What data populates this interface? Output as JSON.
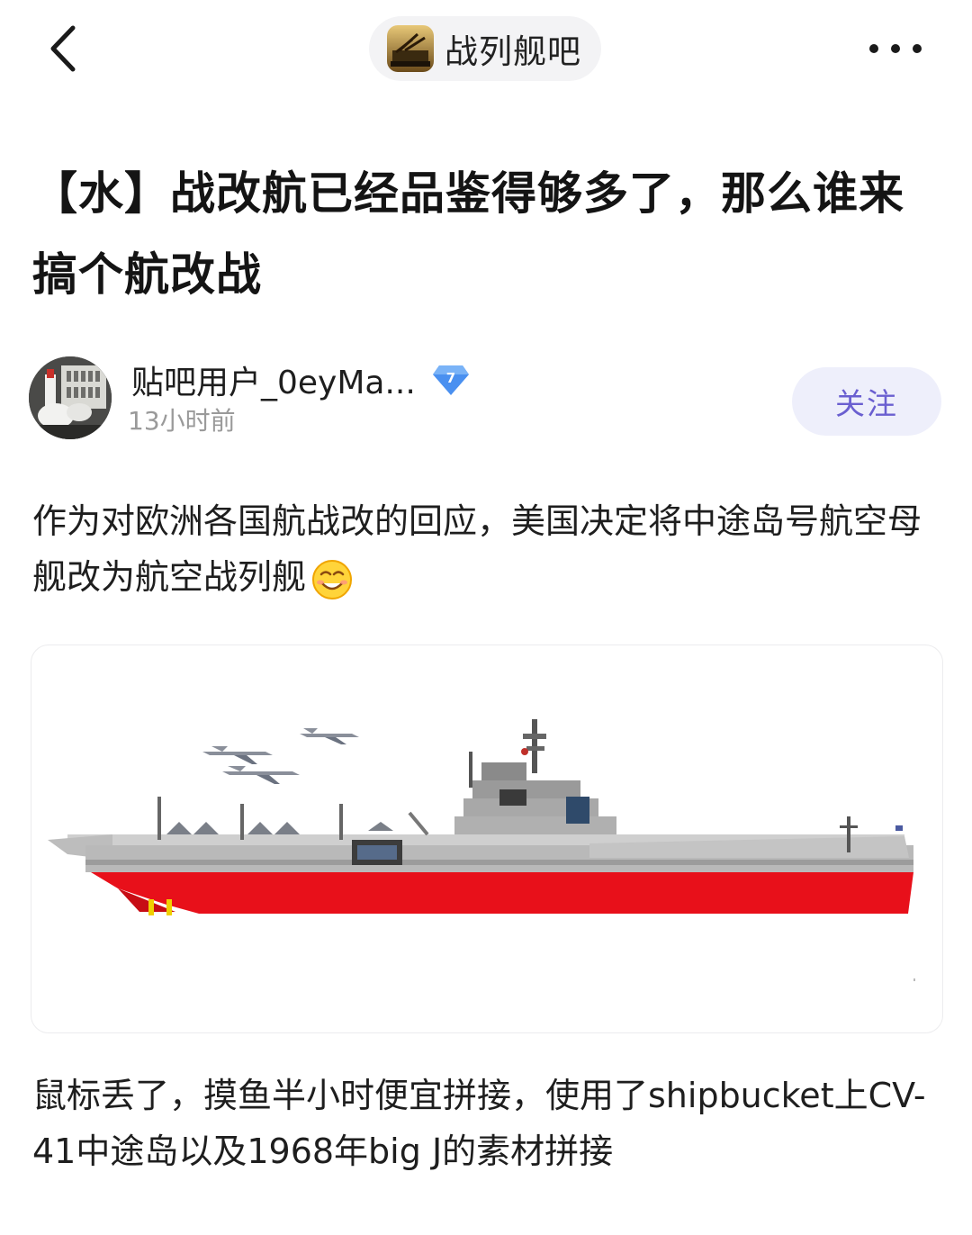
{
  "topbar": {
    "back_icon": "chevron-left-icon",
    "forum_name": "战列舰吧",
    "more_icon": "more-horizontal-icon"
  },
  "post": {
    "title": "【水】战改航已经品鉴得够多了，那么谁来搞个航改战",
    "author": {
      "name": "贴吧用户_0eyMa...",
      "level": "7",
      "time": "13小时前",
      "follow_label": "关注"
    },
    "paragraph1": "作为对欧洲各国航战改的回应，美国决定将中途岛号航空母舰改为航空战列舰",
    "paragraph2": "鼠标丢了，摸鱼半小时便宜拼接，使用了shipbucket上CV-41中途岛以及1968年big J的素材拼接",
    "image_icon": "ship-drawing-image"
  },
  "colors": {
    "accent": "#6a5fd0",
    "follow_bg": "#eeeffb",
    "pill_bg": "#f3f3f5",
    "hull_red": "#e8101a",
    "hull_gray": "#b9b9b9",
    "badge_blue": "#4a90f0"
  }
}
